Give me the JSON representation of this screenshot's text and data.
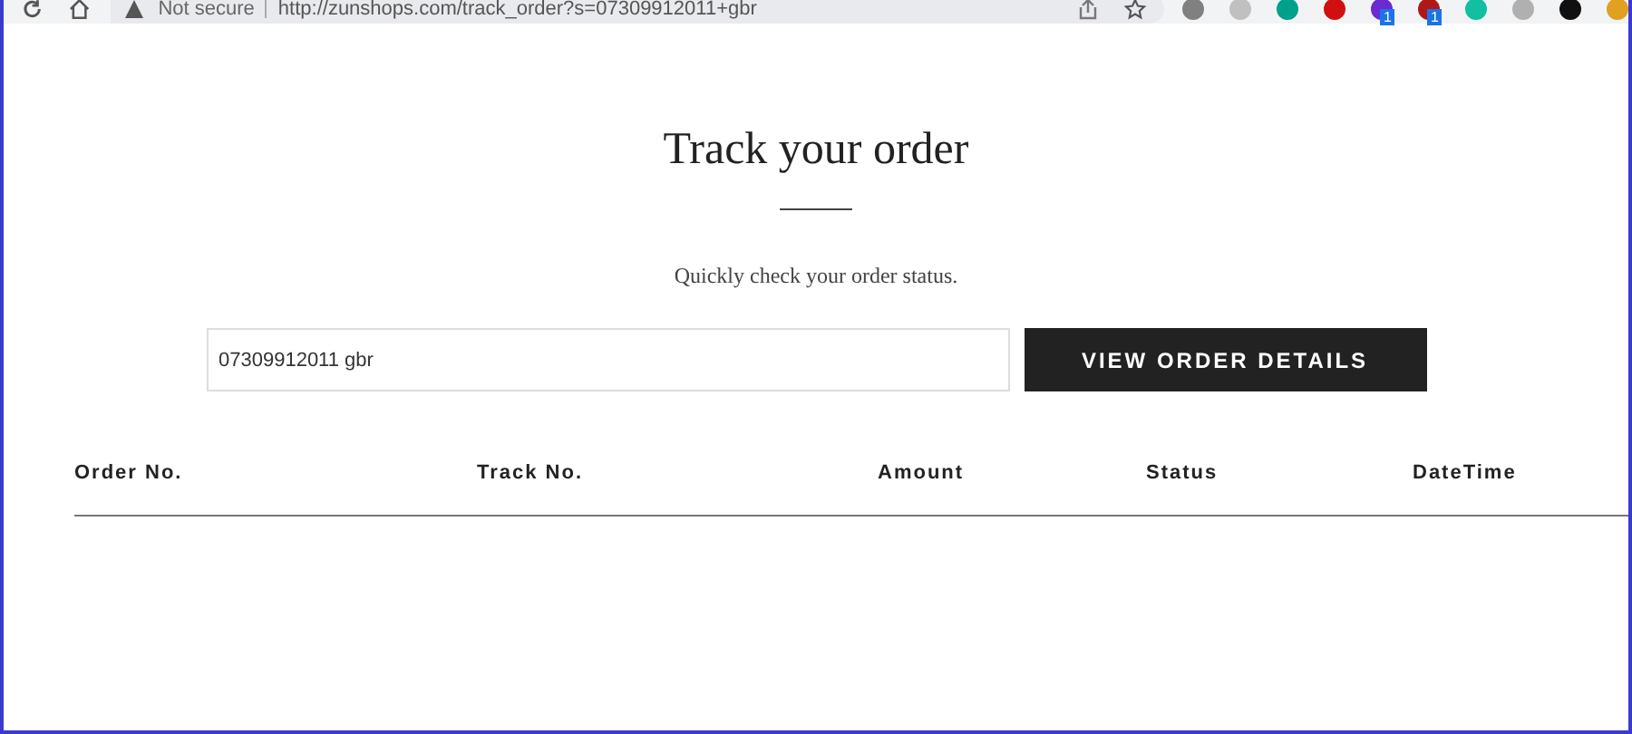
{
  "browser": {
    "security": "Not secure",
    "url": "http://zunshops.com/track_order?s=07309912011+gbr",
    "extensions": [
      {
        "color": "#808080"
      },
      {
        "color": "#c0c0c0"
      },
      {
        "color": "#00a08a"
      },
      {
        "color": "#d01010"
      },
      {
        "color": "#6a2bd0",
        "badge": "1"
      },
      {
        "color": "#b01818",
        "badge": "1"
      },
      {
        "color": "#10c0a0"
      },
      {
        "color": "#b0b0b0"
      },
      {
        "color": "#101010"
      },
      {
        "color": "#e0a020"
      }
    ]
  },
  "page": {
    "title": "Track your order",
    "subtitle": "Quickly check your order status.",
    "search": {
      "value": "07309912011 gbr"
    },
    "button": "VIEW ORDER DETAILS"
  },
  "table": {
    "columns": [
      "Order No.",
      "Track No.",
      "Amount",
      "Status",
      "DateTime"
    ]
  }
}
